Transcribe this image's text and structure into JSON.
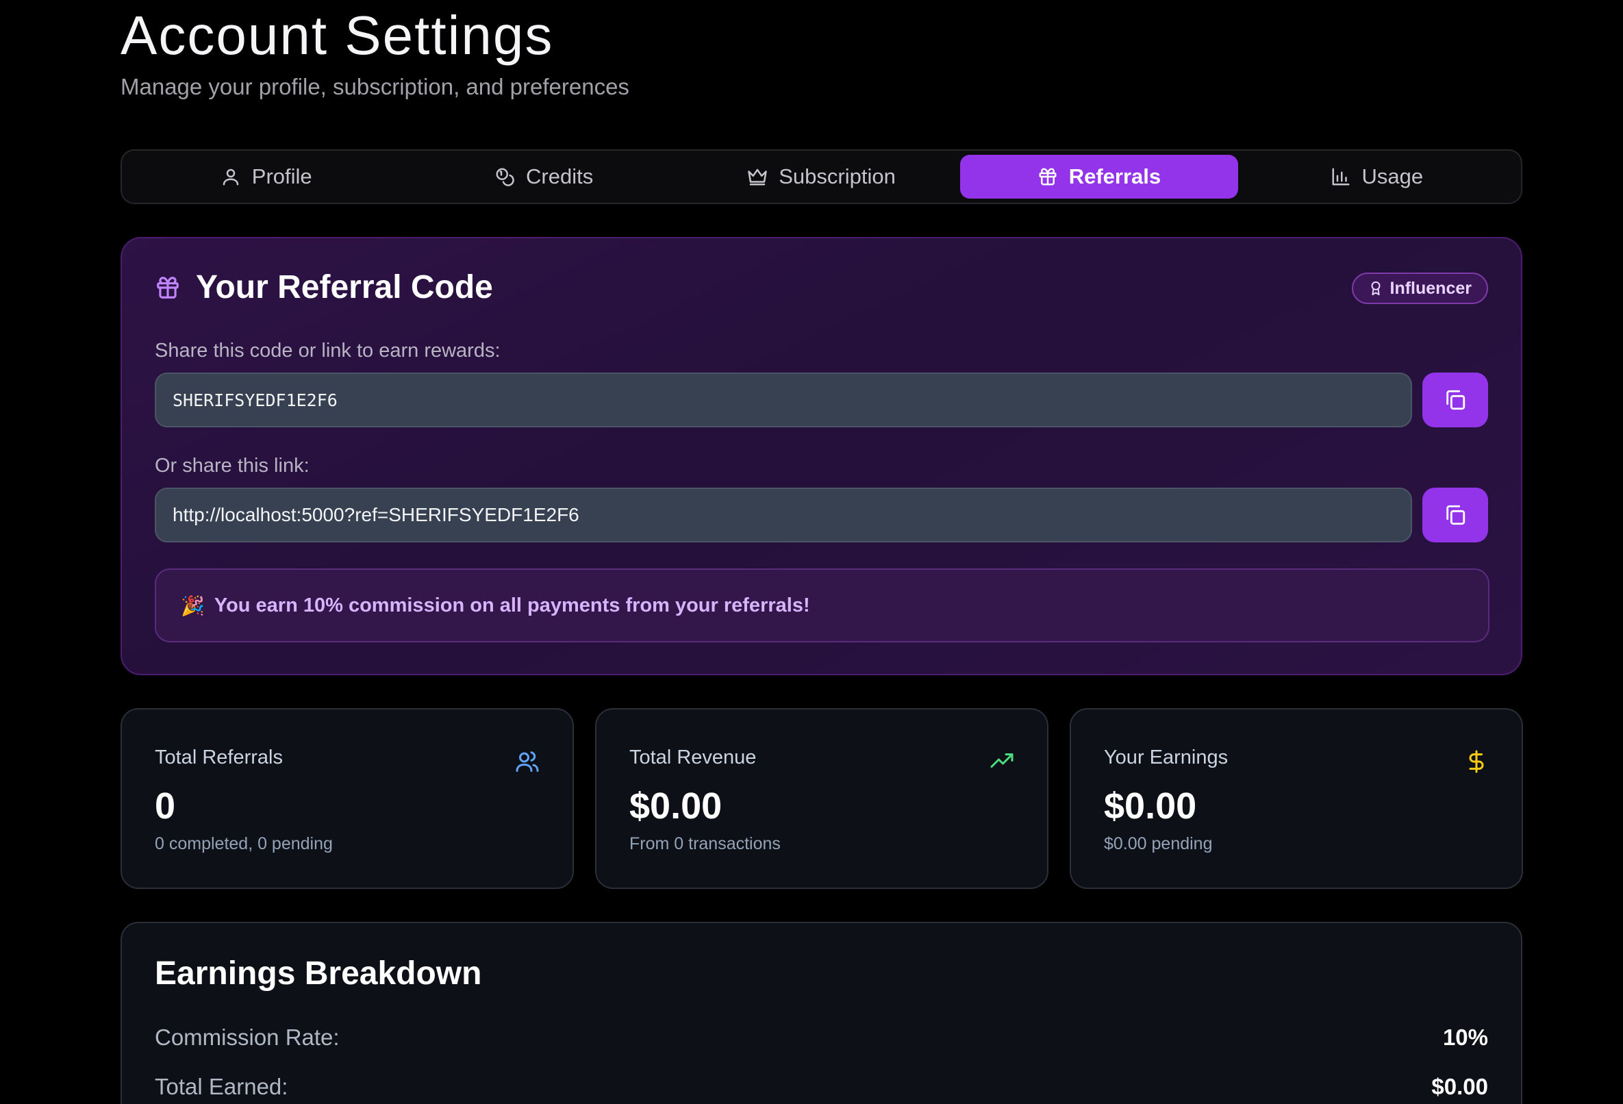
{
  "header": {
    "title": "Account Settings",
    "subtitle": "Manage your profile, subscription, and preferences"
  },
  "tabs": [
    {
      "label": "Profile",
      "icon": "user-icon",
      "active": false
    },
    {
      "label": "Credits",
      "icon": "coins-icon",
      "active": false
    },
    {
      "label": "Subscription",
      "icon": "crown-icon",
      "active": false
    },
    {
      "label": "Referrals",
      "icon": "gift-icon",
      "active": true
    },
    {
      "label": "Usage",
      "icon": "bar-chart-icon",
      "active": false
    }
  ],
  "referral": {
    "title": "Your Referral Code",
    "badge": "Influencer",
    "code_label": "Share this code or link to earn rewards:",
    "code": "SHERIFSYEDF1E2F6",
    "link_label": "Or share this link:",
    "link": "http://localhost:5000?ref=SHERIFSYEDF1E2F6",
    "commission_emoji": "🎉",
    "commission_text": "You earn 10% commission on all payments from your referrals!"
  },
  "stats": [
    {
      "label": "Total Referrals",
      "value": "0",
      "sub": "0 completed, 0 pending",
      "icon": "users-icon",
      "icon_color": "#60a5fa"
    },
    {
      "label": "Total Revenue",
      "value": "$0.00",
      "sub": "From 0 transactions",
      "icon": "trending-up-icon",
      "icon_color": "#4ade80"
    },
    {
      "label": "Your Earnings",
      "value": "$0.00",
      "sub": "$0.00 pending",
      "icon": "dollar-icon",
      "icon_color": "#facc15"
    }
  ],
  "earnings": {
    "title": "Earnings Breakdown",
    "rows": [
      {
        "label": "Commission Rate:",
        "value": "10%"
      },
      {
        "label": "Total Earned:",
        "value": "$0.00"
      }
    ]
  },
  "colors": {
    "accent": "#9333ea",
    "background": "#000000",
    "card": "#0d1117"
  }
}
